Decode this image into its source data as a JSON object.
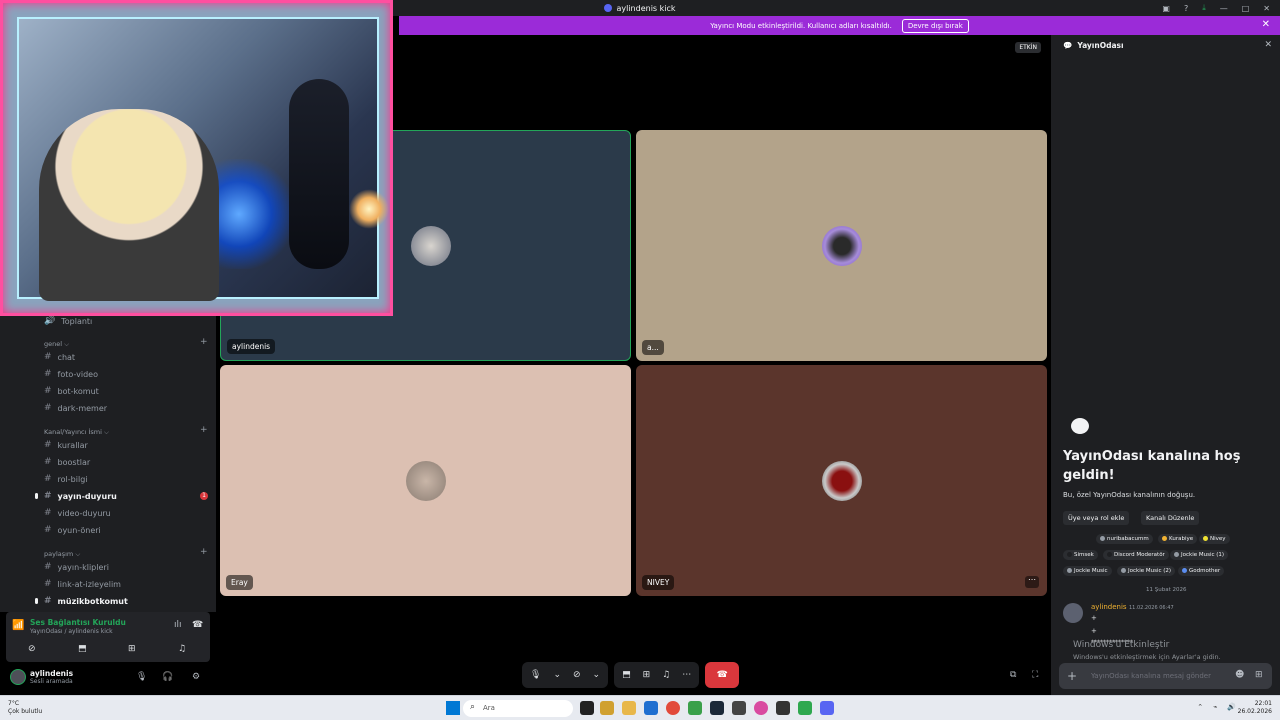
{
  "window": {
    "title": "aylindenis kick"
  },
  "banner": {
    "text": "Yayıncı Modu etkinleştirildi. Kullanıcı adları kısaltıldı.",
    "button": "Devre dışı bırak"
  },
  "sidebar": {
    "first_channel": "Toplantı",
    "categories": [
      {
        "name": "genel ⌵",
        "channels": [
          "chat",
          "foto-video",
          "bot-komut",
          "dark-memer"
        ]
      },
      {
        "name": "Kanal/Yayıncı İsmi ⌵",
        "channels": [
          "kurallar",
          "boostlar",
          "rol-bilgi",
          "yayın-duyuru",
          "video-duyuru",
          "oyun-öneri"
        ]
      },
      {
        "name": "paylaşım ⌵",
        "channels": [
          "yayın-klipleri",
          "link-at-izleyelim",
          "müzikbotkomut"
        ]
      }
    ],
    "unread_badge": "1"
  },
  "voice": {
    "status": "Ses Bağlantısı Kuruldu",
    "location": "YayınOdası / aylindenis kick"
  },
  "user": {
    "name": "aylindenis",
    "status": "Sesli aramada"
  },
  "stage": {
    "live_label": "ETKİN",
    "tiles": [
      {
        "name": "aylindenis",
        "bg": "#2b3a4a"
      },
      {
        "name": "a...",
        "bg": "#b3a38a"
      },
      {
        "name": "Eray",
        "bg": "#dcc0b2"
      },
      {
        "name": "NIVEY",
        "bg": "#5b352c"
      }
    ]
  },
  "chat": {
    "header": "YayınOdası",
    "welcome": "YayınOdası kanalına hoş geldin!",
    "description": "Bu, özel YayınOdası kanalının doğuşu.",
    "action_add": "Üye veya rol ekle",
    "action_edit": "Kanalı Düzenle",
    "chips": [
      {
        "label": "nuribabacumm",
        "color": "#949ba4"
      },
      {
        "label": "Kurabiye",
        "color": "#f0b232"
      },
      {
        "label": "Nivey",
        "color": "#f0e232"
      },
      {
        "label": "Simsek",
        "color": "#1e1f22"
      },
      {
        "label": "Discord Moderatör",
        "color": "#1e1f22"
      },
      {
        "label": "Jockie Music (1)",
        "color": "#949ba4"
      },
      {
        "label": "Jockie Music",
        "color": "#949ba4"
      },
      {
        "label": "Jockie Music (2)",
        "color": "#949ba4"
      },
      {
        "label": "Godmother",
        "color": "#5b8def"
      }
    ],
    "date_divider": "11 Şubat 2026",
    "message": {
      "user": "aylindenis",
      "time": "11.02.2026 06:47",
      "lines": [
        "+",
        "+",
        "**************"
      ]
    },
    "watermark_title": "Windows'u Etkinleştir",
    "watermark_sub": "Windows'u etkinleştirmek için Ayarlar'a gidin.",
    "input_placeholder": "YayınOdası kanalına mesaj gönder"
  },
  "taskbar": {
    "weather_temp": "7°C",
    "weather_desc": "Çok bulutlu",
    "search": "Ara",
    "time": "22:01",
    "date": "26.02.2026"
  },
  "colors": {
    "accent": "#5865f2",
    "online": "#23a559",
    "banner": "#9b2bd8",
    "danger": "#da373c"
  }
}
